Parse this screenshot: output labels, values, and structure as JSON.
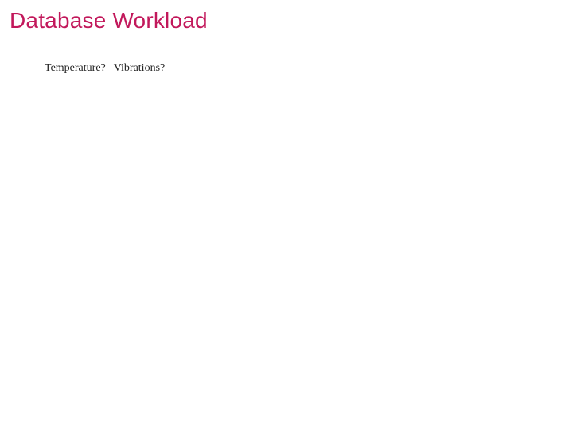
{
  "slide": {
    "title": "Database Workload",
    "sub": {
      "item1": "Temperature?",
      "item2": "Vibrations?"
    }
  },
  "colors": {
    "accent": "#c2185b",
    "text": "#222222",
    "background": "#ffffff"
  }
}
